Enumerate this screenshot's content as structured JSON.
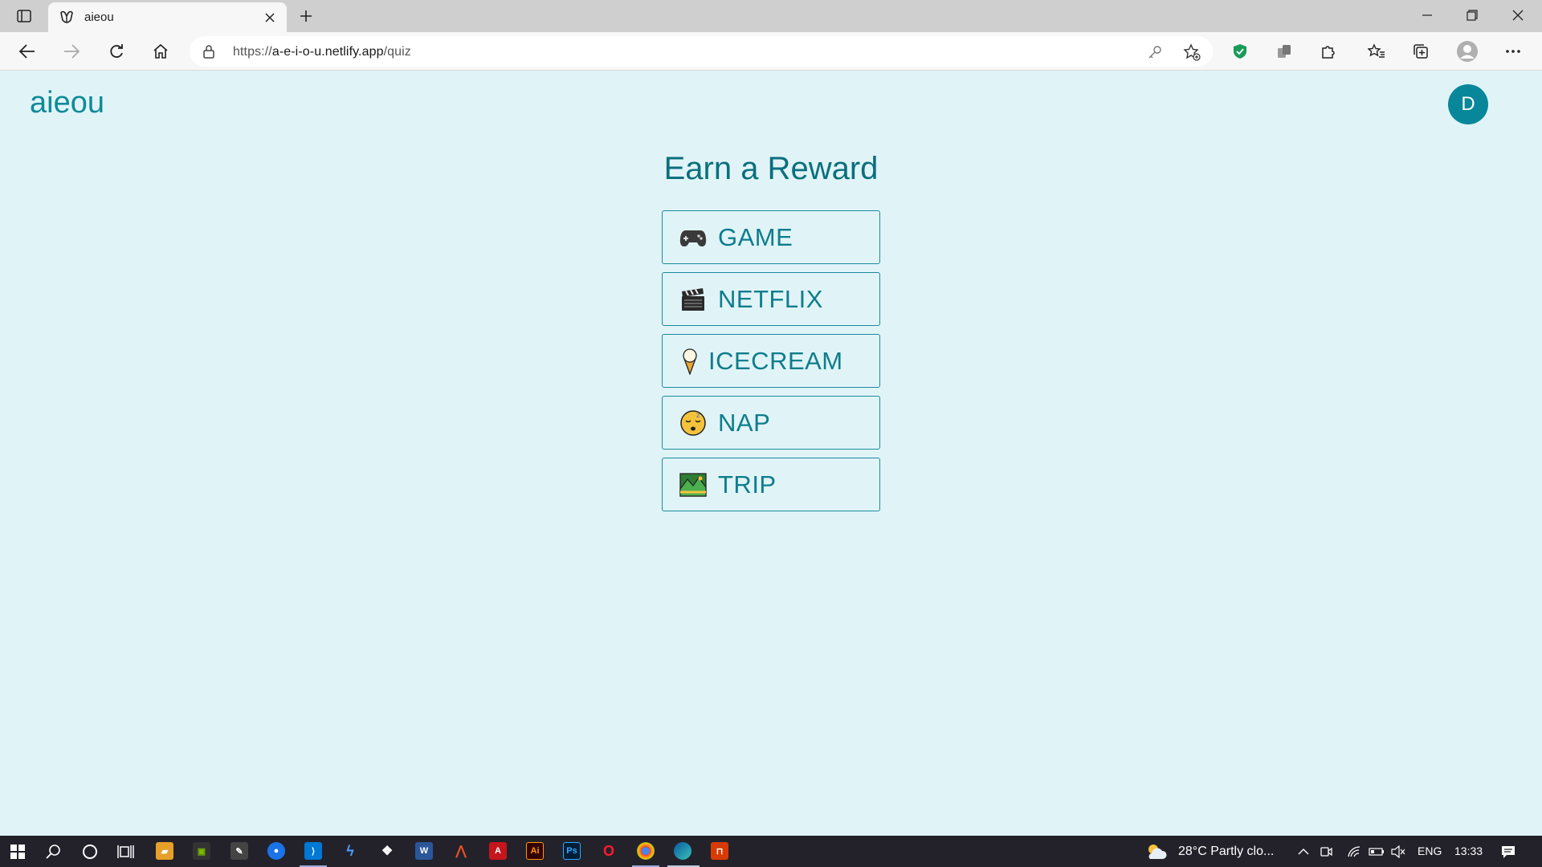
{
  "browser": {
    "tab_title": "aieou",
    "url_prefix": "https://",
    "url_host": "a-e-i-o-u.netlify.app",
    "url_path": "/quiz"
  },
  "page": {
    "brand": "aieou",
    "avatar_initial": "D",
    "heading": "Earn a Reward",
    "options": [
      {
        "label": "GAME",
        "icon": "game-controller-icon"
      },
      {
        "label": "NETFLIX",
        "icon": "clapper-board-icon"
      },
      {
        "label": "ICECREAM",
        "icon": "ice-cream-icon"
      },
      {
        "label": "NAP",
        "icon": "sleeping-face-icon"
      },
      {
        "label": "TRIP",
        "icon": "national-park-icon"
      }
    ],
    "colors": {
      "background": "#e0f4f8",
      "accent": "#0e8a99",
      "heading": "#0b6f7d",
      "avatar": "#08879a"
    }
  },
  "taskbar": {
    "weather": "28°C  Partly clo...",
    "language": "ENG",
    "time": "13:33"
  }
}
